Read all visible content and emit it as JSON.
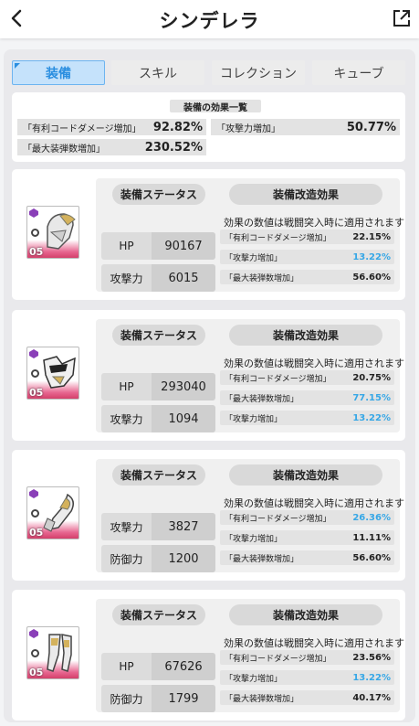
{
  "header": {
    "title": "シンデレラ"
  },
  "tabs": [
    "装備",
    "スキル",
    "コレクション",
    "キューブ"
  ],
  "summary": {
    "title": "装備の効果一覧",
    "items": [
      {
        "label": "「有利コードダメージ増加」",
        "value": "92.82%"
      },
      {
        "label": "「攻撃力増加」",
        "value": "50.77%"
      },
      {
        "label": "「最大装弾数増加」",
        "value": "230.52%"
      }
    ]
  },
  "section_labels": {
    "status": "装備ステータス",
    "effect": "装備改造効果",
    "note": "効果の数値は戦闘突入時に適用されます"
  },
  "cards": [
    {
      "level": "05",
      "stats": [
        {
          "label": "HP",
          "value": "90167"
        },
        {
          "label": "攻撃力",
          "value": "6015"
        }
      ],
      "effects": [
        {
          "label": "「有利コードダメージ増加」",
          "value": "22.15%",
          "highlight": false
        },
        {
          "label": "「攻撃力増加」",
          "value": "13.22%",
          "highlight": true
        },
        {
          "label": "「最大装弾数増加」",
          "value": "56.60%",
          "highlight": false
        }
      ]
    },
    {
      "level": "05",
      "stats": [
        {
          "label": "HP",
          "value": "293040"
        },
        {
          "label": "攻撃力",
          "value": "1094"
        }
      ],
      "effects": [
        {
          "label": "「有利コードダメージ増加」",
          "value": "20.75%",
          "highlight": false
        },
        {
          "label": "「最大装弾数増加」",
          "value": "77.15%",
          "highlight": true
        },
        {
          "label": "「攻撃力増加」",
          "value": "13.22%",
          "highlight": true
        }
      ]
    },
    {
      "level": "05",
      "stats": [
        {
          "label": "攻撃力",
          "value": "3827"
        },
        {
          "label": "防御力",
          "value": "1200"
        }
      ],
      "effects": [
        {
          "label": "「有利コードダメージ増加」",
          "value": "26.36%",
          "highlight": true
        },
        {
          "label": "「攻撃力増加」",
          "value": "11.11%",
          "highlight": false
        },
        {
          "label": "「最大装弾数増加」",
          "value": "56.60%",
          "highlight": false
        }
      ]
    },
    {
      "level": "05",
      "stats": [
        {
          "label": "HP",
          "value": "67626"
        },
        {
          "label": "防御力",
          "value": "1799"
        }
      ],
      "effects": [
        {
          "label": "「有利コードダメージ増加」",
          "value": "23.56%",
          "highlight": false
        },
        {
          "label": "「攻撃力増加」",
          "value": "13.22%",
          "highlight": true
        },
        {
          "label": "「最大装弾数増加」",
          "value": "40.17%",
          "highlight": false
        }
      ]
    }
  ],
  "colors": {
    "accent": "#2a8ee0",
    "highlight_value": "#36a7e6",
    "thumb_pink": "#d3406b"
  },
  "icons": {
    "back": "chevron-left-icon",
    "external": "external-link-icon"
  }
}
